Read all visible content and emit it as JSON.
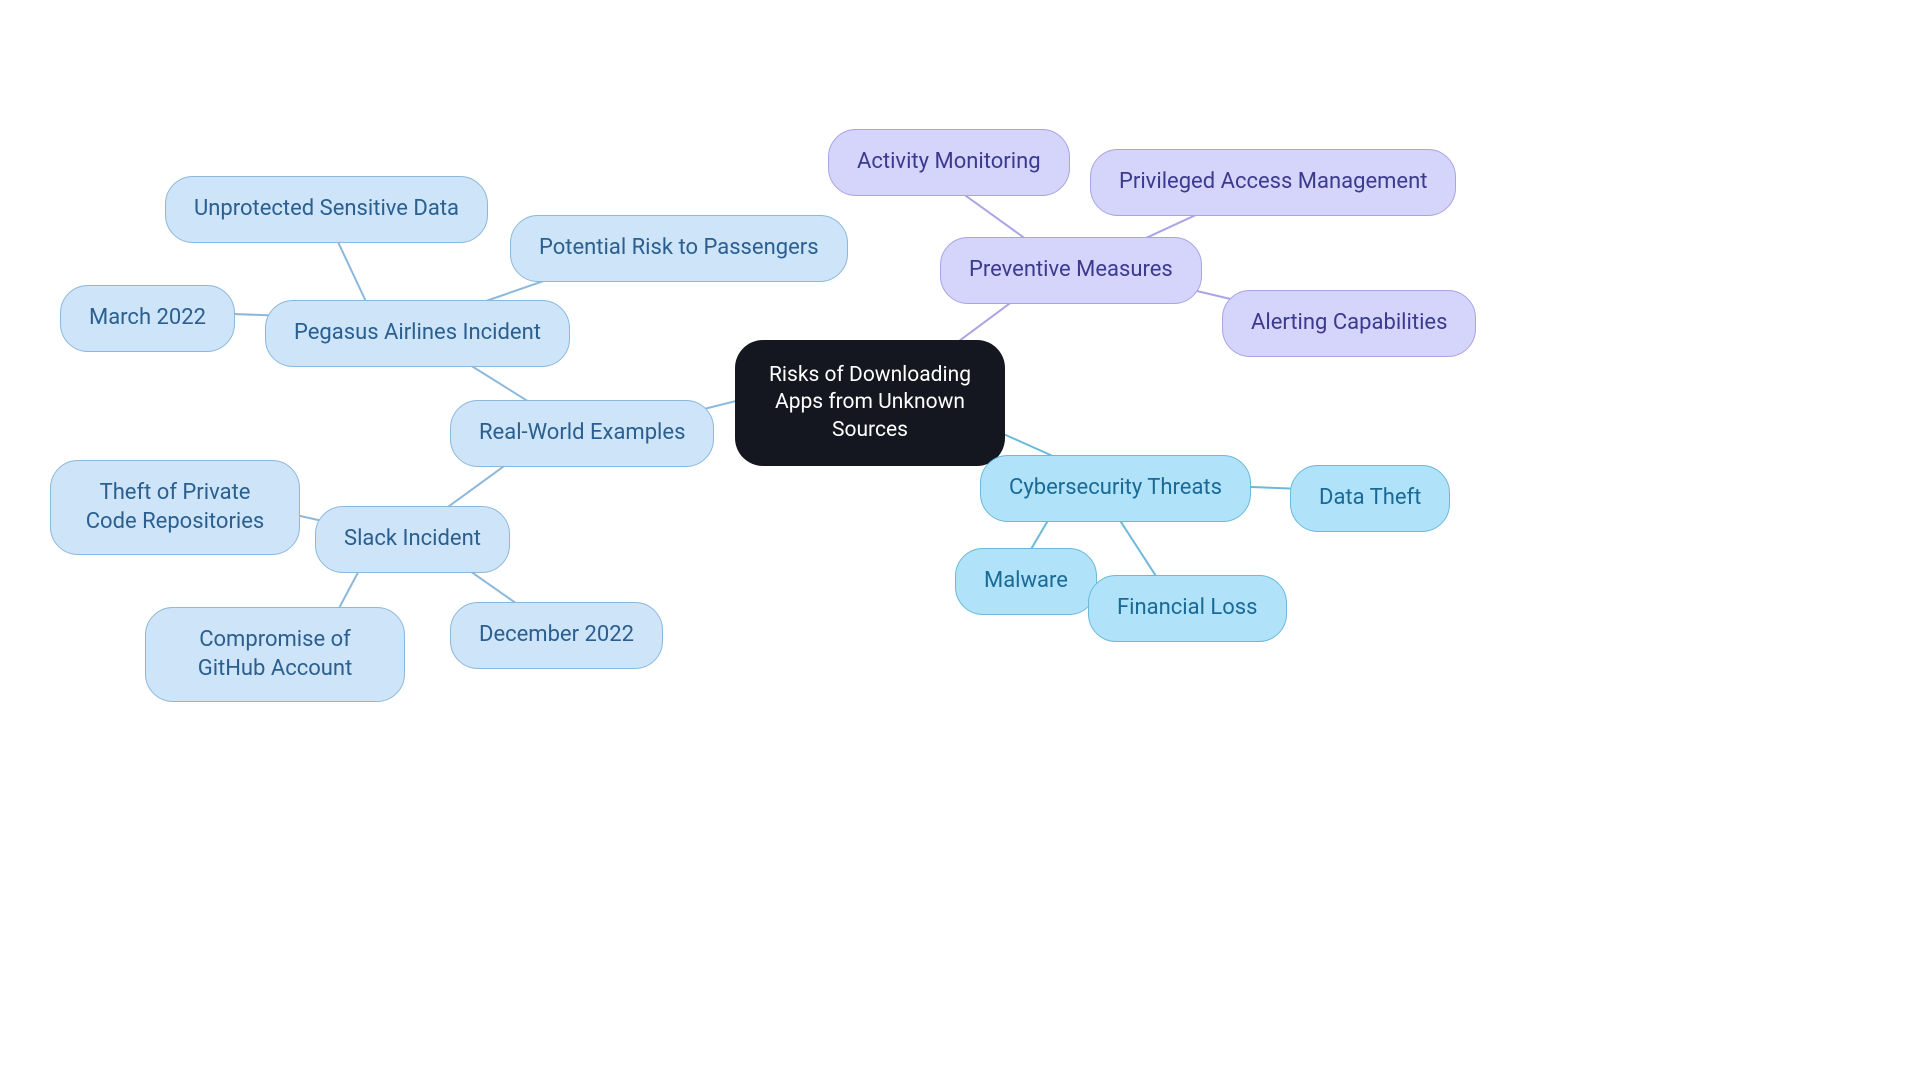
{
  "center": {
    "label": "Risks of Downloading Apps from Unknown Sources"
  },
  "branches": {
    "preventive": {
      "label": "Preventive Measures",
      "children": {
        "activity": "Activity Monitoring",
        "pam": "Privileged Access Management",
        "alerting": "Alerting Capabilities"
      }
    },
    "threats": {
      "label": "Cybersecurity Threats",
      "children": {
        "malware": "Malware",
        "financial": "Financial Loss",
        "datatheft": "Data Theft"
      }
    },
    "examples": {
      "label": "Real-World Examples",
      "children": {
        "pegasus": {
          "label": "Pegasus Airlines Incident",
          "children": {
            "date": "March 2022",
            "unprotected": "Unprotected Sensitive Data",
            "risk": "Potential Risk to Passengers"
          }
        },
        "slack": {
          "label": "Slack Incident",
          "children": {
            "date": "December 2022",
            "github": "Compromise of GitHub Account",
            "theft": "Theft of Private Code Repositories"
          }
        }
      }
    }
  }
}
